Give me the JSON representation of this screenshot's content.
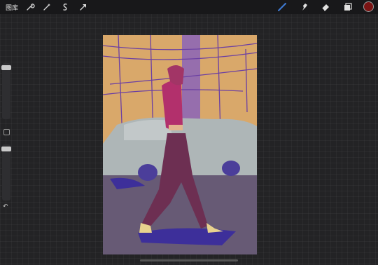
{
  "toolbar": {
    "gallery_label": "图库",
    "left_tools": [
      "wrench-icon",
      "magic-wand-icon",
      "selection-icon",
      "transform-arrow-icon"
    ],
    "right_tools": [
      "brush-icon",
      "smudge-icon",
      "eraser-icon",
      "layers-icon"
    ],
    "accent_color": "#3f7bd6",
    "current_color": "#7a1414"
  },
  "sidebar": {
    "undo_glyph": "↶"
  },
  "canvas": {
    "colors": {
      "sky": "#d9a86a",
      "car": "#aeb6b7",
      "street": "#675a75",
      "shadow": "#3d2f9a",
      "jacket": "#b2306c",
      "hair": "#a23566",
      "pants": "#6d2f52",
      "lines": "#6b3fa3"
    }
  }
}
